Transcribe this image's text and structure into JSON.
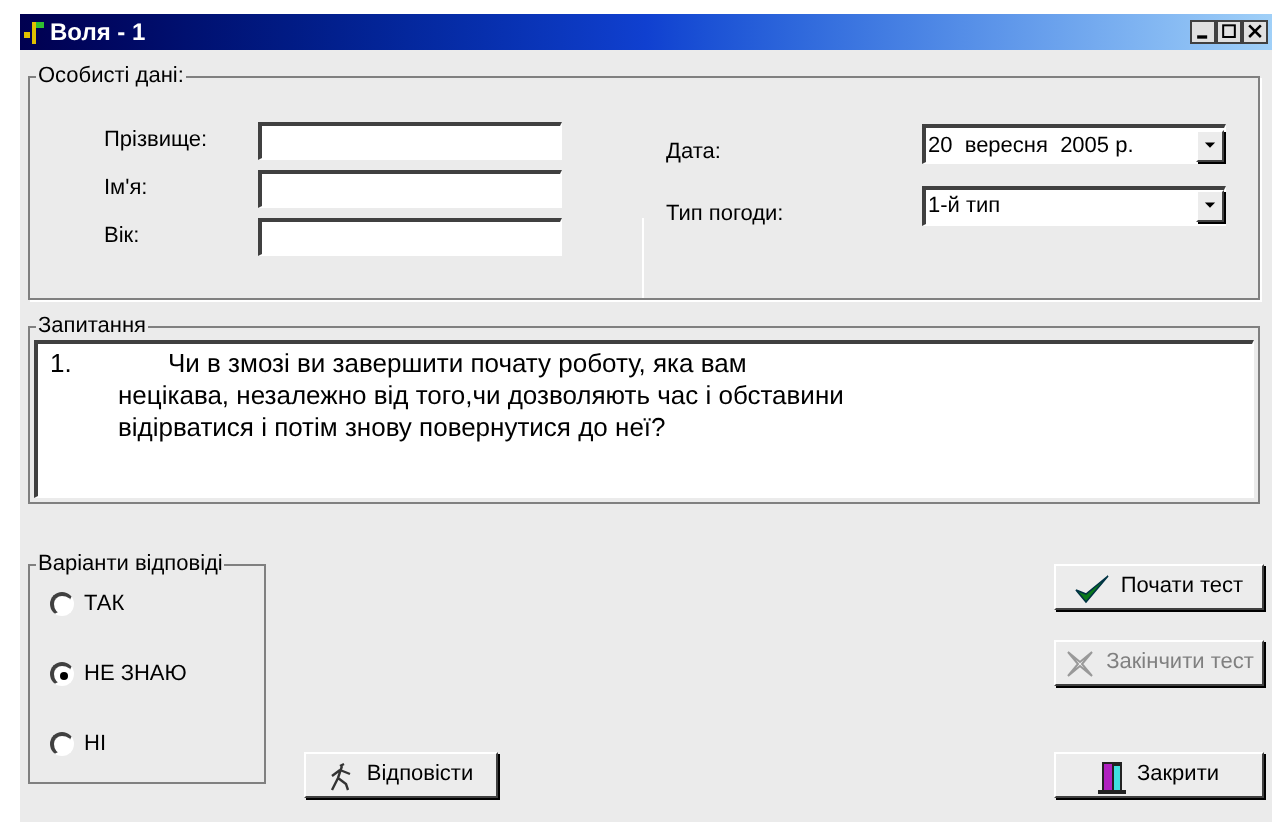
{
  "window": {
    "title": "Воля - 1"
  },
  "personal": {
    "title": "Особисті дані:",
    "fields": [
      {
        "label": "Прізвище:"
      },
      {
        "label": "Ім'я:"
      },
      {
        "label": "Вік:"
      }
    ],
    "combos": [
      {
        "label": "Дата:",
        "value": "20  вересня  2005 р."
      },
      {
        "label": "Тип погоди:",
        "value": "1-й тип"
      }
    ]
  },
  "question": {
    "title": "Запитання",
    "number": "1.",
    "text": "Чи в змозі ви завершити почату роботу, яка вам\nнецікава, незалежно від того,чи дозволяють час і обставини\nвідірватися і потім знову повернутися до неї?"
  },
  "answers": {
    "title": "Варіанти відповіді",
    "options": [
      {
        "label": "ТАК",
        "selected": false
      },
      {
        "label": "НЕ ЗНАЮ",
        "selected": true
      },
      {
        "label": "НІ",
        "selected": false
      }
    ]
  },
  "buttons": [
    {
      "kind": "answer",
      "label": "Відповісти",
      "disabled": false
    },
    {
      "kind": "start",
      "label": "Почати тест",
      "disabled": false
    },
    {
      "kind": "finish",
      "label": "Закінчити тест",
      "disabled": true
    },
    {
      "kind": "close",
      "label": "Закрити",
      "disabled": false
    }
  ]
}
